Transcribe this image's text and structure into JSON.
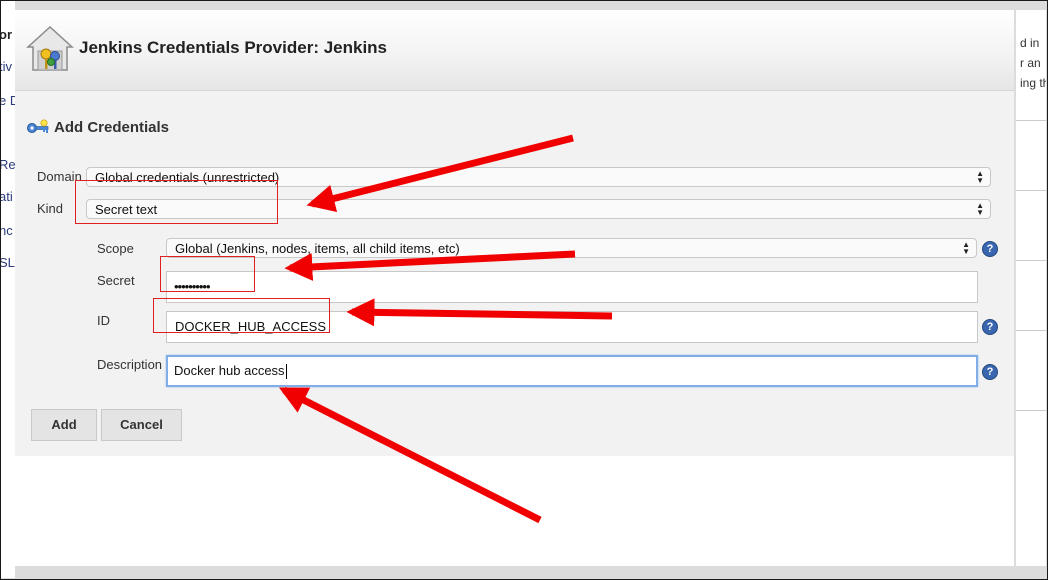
{
  "background": {
    "left_fragments": [
      "or",
      "tiv",
      "e D",
      "Re",
      "ati",
      "nc",
      "SL"
    ],
    "right_fragments": [
      "d in",
      "r an",
      "ing th"
    ]
  },
  "dialog": {
    "title": "Jenkins Credentials Provider: Jenkins",
    "section_title": "Add Credentials",
    "logo_icon": "jenkins-house-key-icon",
    "section_icon": "key-icon"
  },
  "form": {
    "domain": {
      "label": "Domain",
      "value": "Global credentials (unrestricted)"
    },
    "kind": {
      "label": "Kind",
      "value": "Secret text"
    },
    "scope": {
      "label": "Scope",
      "value": "Global (Jenkins, nodes, items, all child items, etc)"
    },
    "secret": {
      "label": "Secret",
      "value": "••••••••••"
    },
    "id": {
      "label": "ID",
      "value": "DOCKER_HUB_ACCESS"
    },
    "description": {
      "label": "Description",
      "value": "Docker hub access"
    },
    "help_symbol": "?"
  },
  "buttons": {
    "add": "Add",
    "cancel": "Cancel"
  },
  "annotations": {
    "highlight_color": "#e02020",
    "arrow_color": "#f00000"
  }
}
